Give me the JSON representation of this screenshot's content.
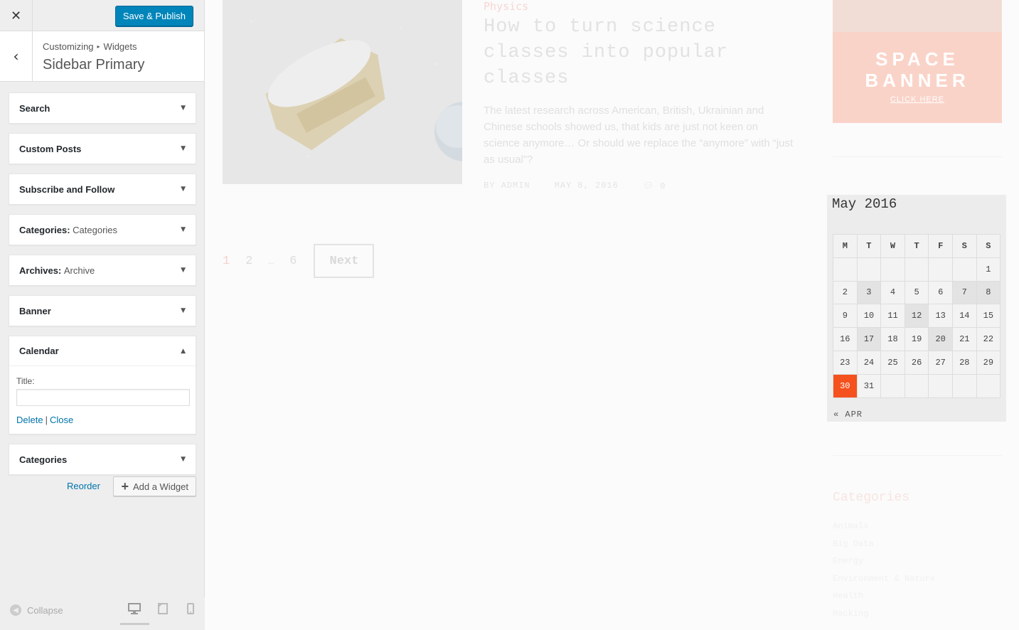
{
  "customizer": {
    "close_icon": "close-icon",
    "save_label": "Save & Publish",
    "breadcrumb": {
      "root": "Customizing",
      "parent": "Widgets"
    },
    "section_title": "Sidebar Primary",
    "widgets": [
      {
        "title": "Search",
        "instance": "",
        "open": false
      },
      {
        "title": "Custom Posts",
        "instance": "",
        "open": false
      },
      {
        "title": "Subscribe and Follow",
        "instance": "",
        "open": false
      },
      {
        "title": "Categories:",
        "instance": "Categories",
        "open": false
      },
      {
        "title": "Archives:",
        "instance": "Archive",
        "open": false
      },
      {
        "title": "Banner",
        "instance": "",
        "open": false
      },
      {
        "title": "Calendar",
        "instance": "",
        "open": true
      },
      {
        "title": "Categories",
        "instance": "",
        "open": false
      }
    ],
    "calendar_form": {
      "title_label": "Title:",
      "title_value": "",
      "delete_label": "Delete",
      "separator": "|",
      "close_label": "Close"
    },
    "reorder_label": "Reorder",
    "add_widget_label": "Add a Widget",
    "collapse_label": "Collapse",
    "accent_color": "#0085ba"
  },
  "preview": {
    "post": {
      "category": "Physics",
      "title": "How to turn science classes into popular classes",
      "excerpt": "The latest research across American, British, Ukrainian and Chinese schools showed us, that kids are just not keen on science anymore… Or should we replace the “anymore” with “just as usual”?",
      "author": "BY ADMIN",
      "date": "MAY 8, 2016",
      "comments": "0"
    },
    "pagination": {
      "pages": [
        "1",
        "2",
        "…",
        "6"
      ],
      "current": "1",
      "next_label": "Next"
    },
    "banner": {
      "line1": "SPACE",
      "line2": "BANNER",
      "cta": "CLICK HERE"
    },
    "calendar": {
      "caption": "May 2016",
      "weekdays": [
        "M",
        "T",
        "W",
        "T",
        "F",
        "S",
        "S"
      ],
      "weeks": [
        [
          "",
          "",
          "",
          "",
          "",
          "",
          "1"
        ],
        [
          "2",
          "3",
          "4",
          "5",
          "6",
          "7",
          "8"
        ],
        [
          "9",
          "10",
          "11",
          "12",
          "13",
          "14",
          "15"
        ],
        [
          "16",
          "17",
          "18",
          "19",
          "20",
          "21",
          "22"
        ],
        [
          "23",
          "24",
          "25",
          "26",
          "27",
          "28",
          "29"
        ],
        [
          "30",
          "31",
          "",
          "",
          "",
          "",
          ""
        ]
      ],
      "linked_days": [
        "3",
        "7",
        "8",
        "12",
        "17",
        "20"
      ],
      "today": "30",
      "today_color": "#f4511e",
      "prev_label": "« APR"
    },
    "categories_widget": {
      "title": "Categories",
      "items": [
        "Animals",
        "Big Data",
        "Energy",
        "Environment & Nature",
        "Health",
        "Hacking"
      ]
    }
  }
}
